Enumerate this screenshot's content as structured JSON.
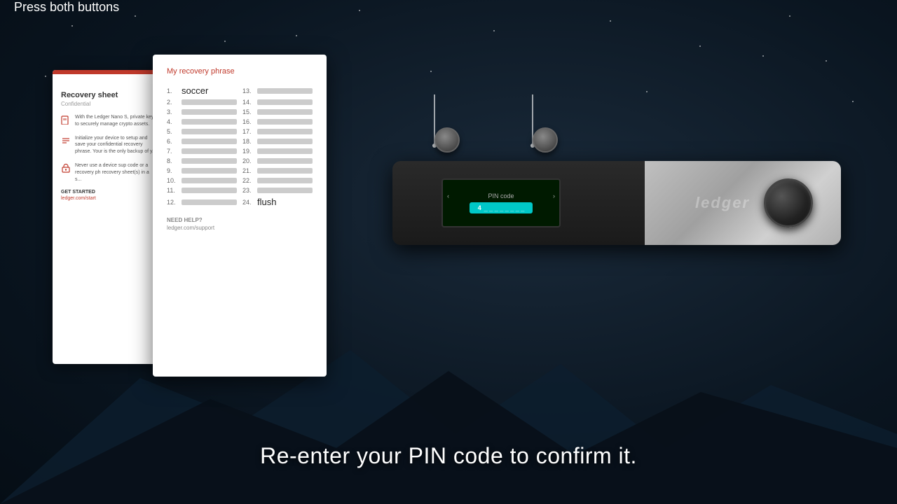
{
  "background": {
    "color": "#0a1520"
  },
  "recovery_sheet": {
    "title": "Recovery sheet",
    "subtitle": "Confidential",
    "sections": [
      {
        "icon": "device-icon",
        "text": "With the Ledger Nano S, private keys to securely manage crypto assets."
      },
      {
        "icon": "list-icon",
        "text": "Initialize your device to setup and save your confidential recovery phrase. Your is the only backup of y..."
      },
      {
        "icon": "lock-icon",
        "text": "Never use a device sup code or a recovery ph recovery sheet(s) in a s..."
      }
    ],
    "get_started_label": "GET STARTED",
    "link": "ledger.com/start"
  },
  "recovery_phrase_card": {
    "title": "My recovery phrase",
    "words": [
      {
        "num": "1.",
        "word": "soccer",
        "visible": true
      },
      {
        "num": "2.",
        "word": "",
        "visible": false
      },
      {
        "num": "3.",
        "word": "",
        "visible": false
      },
      {
        "num": "4.",
        "word": "",
        "visible": false
      },
      {
        "num": "5.",
        "word": "",
        "visible": false
      },
      {
        "num": "6.",
        "word": "",
        "visible": false
      },
      {
        "num": "7.",
        "word": "",
        "visible": false
      },
      {
        "num": "8.",
        "word": "",
        "visible": false
      },
      {
        "num": "9.",
        "word": "",
        "visible": false
      },
      {
        "num": "10.",
        "word": "",
        "visible": false
      },
      {
        "num": "11.",
        "word": "",
        "visible": false
      },
      {
        "num": "12.",
        "word": "",
        "visible": false
      },
      {
        "num": "13.",
        "word": "",
        "visible": false
      },
      {
        "num": "14.",
        "word": "",
        "visible": false
      },
      {
        "num": "15.",
        "word": "",
        "visible": false
      },
      {
        "num": "16.",
        "word": "",
        "visible": false
      },
      {
        "num": "17.",
        "word": "",
        "visible": false
      },
      {
        "num": "18.",
        "word": "",
        "visible": false
      },
      {
        "num": "19.",
        "word": "",
        "visible": false
      },
      {
        "num": "20.",
        "word": "",
        "visible": false
      },
      {
        "num": "21.",
        "word": "",
        "visible": false
      },
      {
        "num": "22.",
        "word": "",
        "visible": false
      },
      {
        "num": "23.",
        "word": "",
        "visible": false
      },
      {
        "num": "24.",
        "word": "flush",
        "visible": true
      }
    ],
    "help_label": "NEED HELP?",
    "help_link": "ledger.com/support"
  },
  "device": {
    "screen": {
      "title": "PIN code",
      "pin_display": "4 _ _ _ _ _ _ _ _",
      "nav_left": "‹",
      "nav_right": "›"
    },
    "logo": "ledger",
    "knob_label": "navigation-knob"
  },
  "annotation": {
    "press_buttons_label": "Press both buttons"
  },
  "subtitle": "Re-enter your PIN code to confirm it."
}
